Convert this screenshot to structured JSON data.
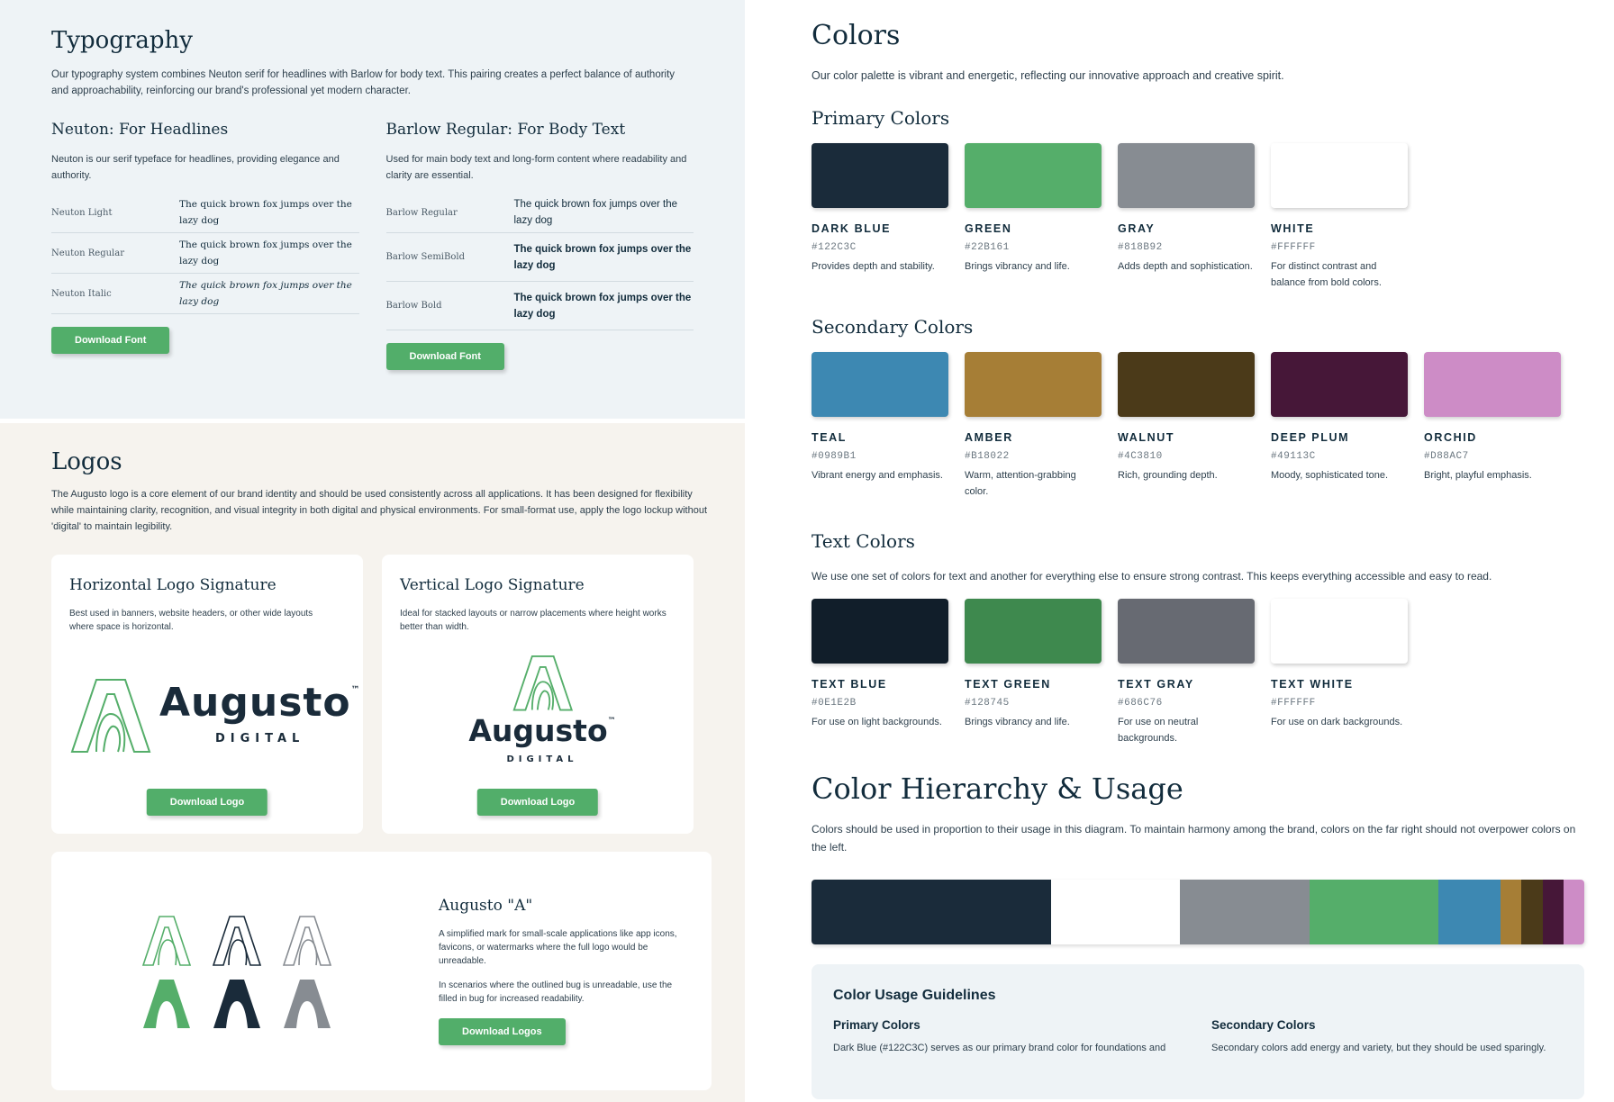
{
  "typography": {
    "title": "Typography",
    "intro": "Our typography system combines Neuton serif for headlines with Barlow for body text. This pairing creates a perfect balance of authority and approachability, reinforcing our brand's professional yet modern character.",
    "neuton": {
      "title": "Neuton: For Headlines",
      "desc": "Neuton is our serif typeface for headlines, providing elegance and authority.",
      "samples": [
        {
          "label": "Neuton Light",
          "text": "The quick brown fox jumps over the lazy dog"
        },
        {
          "label": "Neuton Regular",
          "text": "The quick brown fox jumps over the lazy dog"
        },
        {
          "label": "Neuton Italic",
          "text": "The quick brown fox jumps over the lazy dog"
        }
      ],
      "button": "Download Font"
    },
    "barlow": {
      "title": "Barlow Regular: For Body Text",
      "desc": "Used for main body text and long-form content where readability and clarity are essential.",
      "samples": [
        {
          "label": "Barlow Regular",
          "text": "The quick brown fox jumps over the lazy dog"
        },
        {
          "label": "Barlow SemiBold",
          "text": "The quick brown fox jumps over the lazy dog"
        },
        {
          "label": "Barlow Bold",
          "text": "The quick brown fox jumps over the lazy dog"
        }
      ],
      "button": "Download Font"
    }
  },
  "logos": {
    "title": "Logos",
    "intro": "The Augusto logo is a core element of our brand identity and should be used consistently across all applications. It has been designed for flexibility while maintaining clarity, recognition, and visual integrity in both digital and physical environments. For small-format use, apply the logo lockup without 'digital' to maintain legibility.",
    "horizontal": {
      "title": "Horizontal Logo Signature",
      "desc": "Best used in banners, website headers, or other wide layouts where space is horizontal.",
      "button": "Download Logo"
    },
    "vertical": {
      "title": "Vertical Logo Signature",
      "desc": "Ideal for stacked layouts or narrow placements where height works better than width.",
      "button": "Download Logo"
    },
    "wordmark": "Augusto",
    "tm": "™",
    "tagline": "DIGITAL",
    "mark": {
      "title": "Augusto \"A\"",
      "desc1": "A simplified mark for small-scale applications like app icons, favicons, or watermarks where the full logo would be unreadable.",
      "desc2": "In scenarios where the outlined bug is unreadable, use the filled in bug for increased readability.",
      "button": "Download Logos"
    }
  },
  "colors": {
    "title": "Colors",
    "intro": "Our color palette is vibrant and energetic, reflecting our innovative approach and creative spirit.",
    "primary_title": "Primary Colors",
    "primary": [
      {
        "name": "DARK BLUE",
        "hex": "#122C3C",
        "use": "Provides depth and stability.",
        "color": "#1A2B3A"
      },
      {
        "name": "GREEN",
        "hex": "#22B161",
        "use": "Brings vibrancy and life.",
        "color": "#55AE6A"
      },
      {
        "name": "GRAY",
        "hex": "#818B92",
        "use": "Adds depth and sophistication.",
        "color": "#878C92"
      },
      {
        "name": "WHITE",
        "hex": "#FFFFFF",
        "use": "For distinct contrast and balance from bold colors.",
        "color": "#FFFFFF"
      }
    ],
    "secondary_title": "Secondary Colors",
    "secondary": [
      {
        "name": "TEAL",
        "hex": "#0989B1",
        "use": "Vibrant energy and emphasis.",
        "color": "#3D88B2"
      },
      {
        "name": "AMBER",
        "hex": "#B18022",
        "use": "Warm, attention-grabbing color.",
        "color": "#A67E36"
      },
      {
        "name": "WALNUT",
        "hex": "#4C3810",
        "use": "Rich, grounding depth.",
        "color": "#4B3A19"
      },
      {
        "name": "DEEP PLUM",
        "hex": "#49113C",
        "use": "Moody, sophisticated tone.",
        "color": "#461738"
      },
      {
        "name": "ORCHID",
        "hex": "#D88AC7",
        "use": "Bright, playful emphasis.",
        "color": "#CD8CC6"
      }
    ],
    "text_title": "Text Colors",
    "text_intro": "We use one set of colors for text and another for everything else to ensure strong contrast. This keeps everything accessible and easy to read.",
    "text": [
      {
        "name": "TEXT BLUE",
        "hex": "#0E1E2B",
        "use": "For use on light backgrounds.",
        "color": "#111E2A"
      },
      {
        "name": "TEXT GREEN",
        "hex": "#128745",
        "use": "Brings vibrancy and life.",
        "color": "#3E894E"
      },
      {
        "name": "TEXT GRAY",
        "hex": "#686C76",
        "use": "For use on neutral backgrounds.",
        "color": "#676A72"
      },
      {
        "name": "TEXT WHITE",
        "hex": "#FFFFFF",
        "use": "For use on dark backgrounds.",
        "color": "#FFFFFF"
      }
    ],
    "hierarchy_title": "Color Hierarchy & Usage",
    "hierarchy_intro": "Colors should be used in proportion to their usage in this diagram. To maintain harmony among the brand, colors on the far right should not overpower colors on the left.",
    "hierarchy": [
      {
        "color": "#1A2B3A",
        "share": 0.31
      },
      {
        "color": "#FFFFFF",
        "share": 0.167
      },
      {
        "color": "#878C92",
        "share": 0.167
      },
      {
        "color": "#55AE6A",
        "share": 0.167
      },
      {
        "color": "#3D88B2",
        "share": 0.081
      },
      {
        "color": "#A67E36",
        "share": 0.027
      },
      {
        "color": "#4B3A19",
        "share": 0.027
      },
      {
        "color": "#461738",
        "share": 0.027
      },
      {
        "color": "#CD8CC6",
        "share": 0.027
      }
    ],
    "guidelines": {
      "title": "Color Usage Guidelines",
      "primary_title": "Primary Colors",
      "primary_text": "Dark Blue (#122C3C) serves as our primary brand color for foundations and",
      "secondary_title": "Secondary Colors",
      "secondary_text": "Secondary colors add energy and variety, but they should be used sparingly."
    }
  }
}
